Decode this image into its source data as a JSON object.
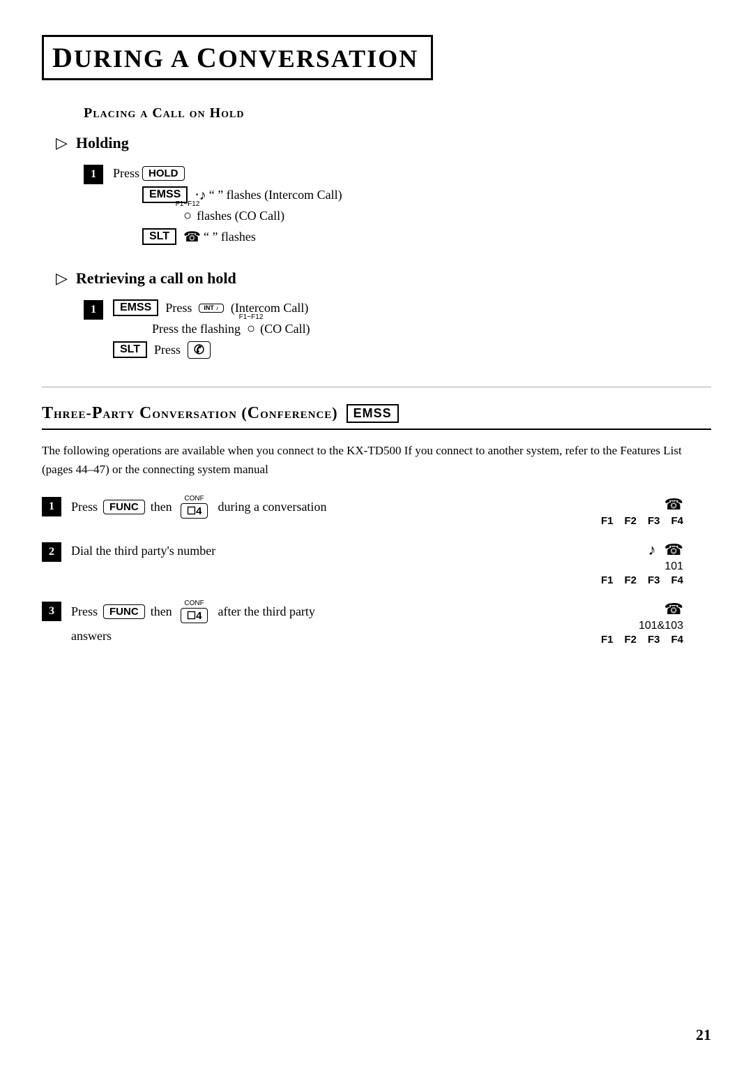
{
  "title": {
    "text": "During a Conversation",
    "drop1": "D",
    "drop2": "C"
  },
  "section1": {
    "heading": "Placing a Call on Hold",
    "subsections": [
      {
        "id": "holding",
        "title": "Holding",
        "steps": [
          {
            "num": "1",
            "main": "Press",
            "key": "HOLD",
            "sub_lines": [
              {
                "label": "EMSS",
                "text": "\" \" flashes (Intercom Call)"
              },
              {
                "label": "",
                "f_range": "F1-F12",
                "text": "flashes (CO Call)"
              },
              {
                "label": "SLT",
                "text": "\" \" flashes"
              }
            ]
          }
        ]
      },
      {
        "id": "retrieving",
        "title": "Retrieving a call on hold",
        "steps": [
          {
            "num": "1",
            "sub_lines": [
              {
                "label": "EMSS",
                "prefix": "Press",
                "key": "INT",
                "text": "(Intercom Call)"
              },
              {
                "label": "",
                "prefix": "Press the flashing",
                "f_range": "F1-F12",
                "text": "(CO Call)"
              },
              {
                "label": "SLT",
                "prefix": "Press",
                "key": "hook",
                "text": ""
              }
            ]
          }
        ]
      }
    ]
  },
  "section2": {
    "heading": "Three-Party Conversation (Conference)",
    "badge": "EMSS",
    "description": "The following operations are available when you connect to the KX-TD500  If you connect to another system, refer to the Features List (pages 44–47) or the connecting system manual",
    "steps": [
      {
        "num": "1",
        "text_prefix": "Press",
        "key1": "FUNC",
        "text_mid": "then",
        "key2": "CONF",
        "key2_num": "4",
        "text_suffix": "during a conversation",
        "diagram": {
          "labels": [
            "F1",
            "F2",
            "F3",
            "F4"
          ],
          "icons": [
            "phone"
          ],
          "number": ""
        }
      },
      {
        "num": "2",
        "text": "Dial the third party's number",
        "diagram": {
          "labels": [
            "F1",
            "F2",
            "F3",
            "F4"
          ],
          "icons": [
            "intercom",
            "phone"
          ],
          "number": "101"
        }
      },
      {
        "num": "3",
        "text_prefix": "Press",
        "key1": "FUNC",
        "text_mid": "then",
        "key2": "CONF",
        "key2_num": "4",
        "text_suffix": "after the third party answers",
        "diagram": {
          "labels": [
            "F1",
            "F2",
            "F3",
            "F4"
          ],
          "icons": [
            "phone"
          ],
          "number": "101&103"
        }
      }
    ]
  },
  "page_number": "21"
}
